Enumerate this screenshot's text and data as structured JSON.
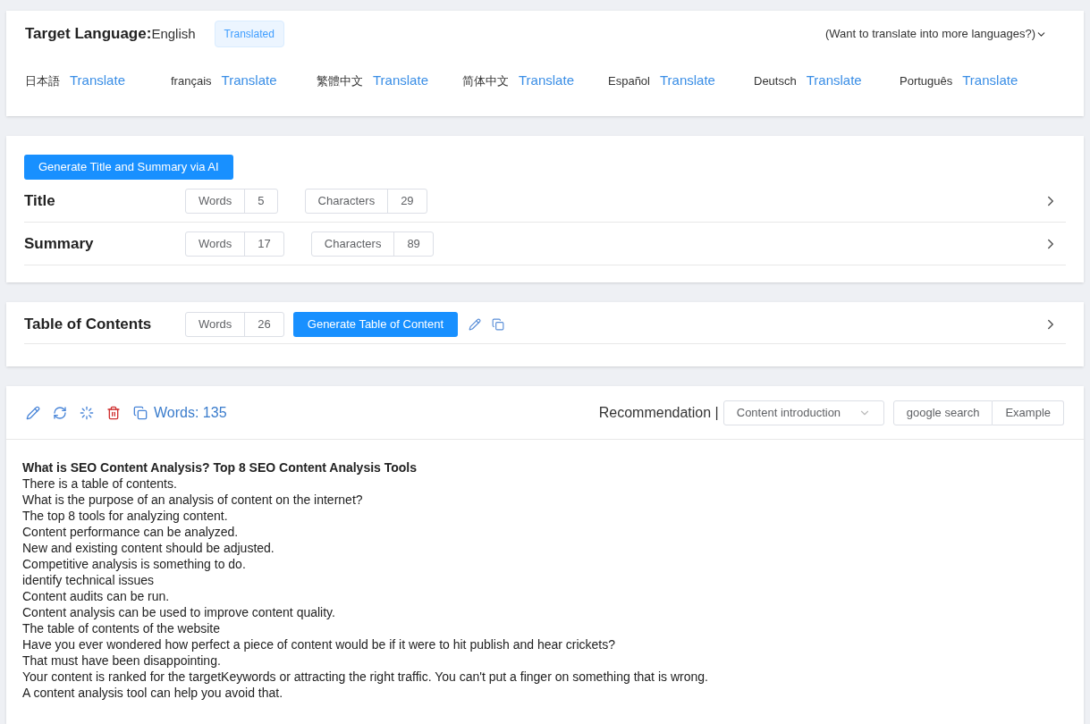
{
  "target_language": {
    "label": "Target Language:",
    "value": "English",
    "status": "Translated",
    "more": "(Want to translate into more languages?)"
  },
  "languages": [
    {
      "name": "日本語",
      "action": "Translate"
    },
    {
      "name": "français",
      "action": "Translate"
    },
    {
      "name": "繁體中文",
      "action": "Translate"
    },
    {
      "name": "简体中文",
      "action": "Translate"
    },
    {
      "name": "Español",
      "action": "Translate"
    },
    {
      "name": "Deutsch",
      "action": "Translate"
    },
    {
      "name": "Português",
      "action": "Translate"
    }
  ],
  "ai_button": "Generate Title and Summary via AI",
  "fields": [
    {
      "label": "Title",
      "words_label": "Words",
      "words": "5",
      "chars_label": "Characters",
      "chars": "29"
    },
    {
      "label": "Summary",
      "words_label": "Words",
      "words": "17",
      "chars_label": "Characters",
      "chars": "89"
    }
  ],
  "toc": {
    "label": "Table of Contents",
    "words_label": "Words",
    "words": "26",
    "button": "Generate Table of Content"
  },
  "editor": {
    "word_count": "Words: 135",
    "recommendation": "Recommendation |",
    "select": "Content introduction",
    "buttons": [
      "google search",
      "Example"
    ],
    "lines": [
      {
        "text": "What is SEO Content Analysis? Top 8 SEO Content Analysis Tools",
        "bold": true
      },
      {
        "text": "There is a table of contents.",
        "bold": false
      },
      {
        "text": "What is the purpose of an analysis of content on the internet?",
        "bold": false
      },
      {
        "text": "The top 8 tools for analyzing content.",
        "bold": false
      },
      {
        "text": "Content performance can be analyzed.",
        "bold": false
      },
      {
        "text": "New and existing content should be adjusted.",
        "bold": false
      },
      {
        "text": "Competitive analysis is something to do.",
        "bold": false
      },
      {
        "text": "identify technical issues",
        "bold": false
      },
      {
        "text": "Content audits can be run.",
        "bold": false
      },
      {
        "text": "Content analysis can be used to improve content quality.",
        "bold": false
      },
      {
        "text": "The table of contents of the website",
        "bold": false
      },
      {
        "text": "Have you ever wondered how perfect a piece of content would be if it were to hit publish and hear crickets?",
        "bold": false
      },
      {
        "text": "That must have been disappointing.",
        "bold": false
      },
      {
        "text": "Your content is ranked for the targetKeywords or attracting the right traffic. You can't put a finger on something that is wrong.",
        "bold": false
      },
      {
        "text": "A content analysis tool can help you avoid that.",
        "bold": false
      }
    ]
  }
}
